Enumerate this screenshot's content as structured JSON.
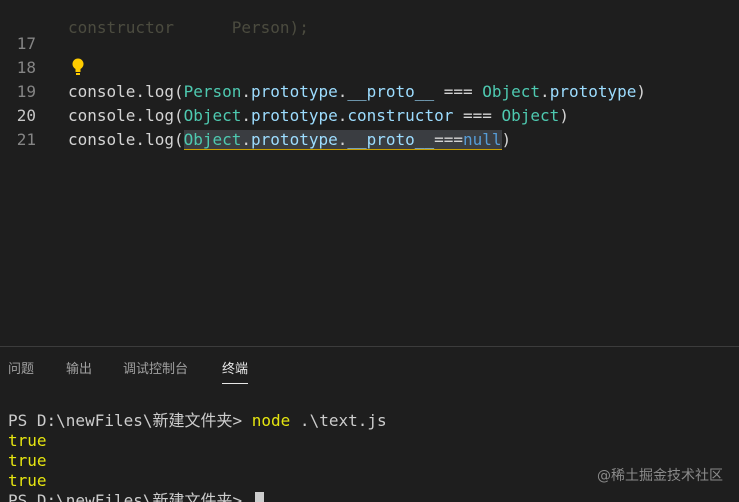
{
  "editor": {
    "top_partial": "constructor      Person);",
    "lines": [
      {
        "num": "17"
      },
      {
        "num": "18",
        "t1": "console.log(",
        "t2": "Person",
        "t3": ".",
        "t4": "prototype",
        "t5": ".",
        "t6": "__proto__",
        "t7": " === ",
        "t8": "Object",
        "t9": ".",
        "t10": "prototype",
        "t11": ")"
      },
      {
        "num": "19",
        "t1": "console.log(",
        "t2": "Object",
        "t3": ".",
        "t4": "prototype",
        "t5": ".",
        "t6": "constructor",
        "t7": " === ",
        "t8": "Object",
        "t9": ")"
      },
      {
        "num": "20",
        "t1": "console.log(",
        "t2": "Object",
        "t3": ".",
        "t4": "prototype",
        "t5": ".",
        "t6": "__proto__",
        "t7": "===",
        "t8": "null",
        "t9": ")"
      },
      {
        "num": "21"
      }
    ]
  },
  "panel": {
    "tabs": [
      "问题",
      "输出",
      "调试控制台",
      "终端"
    ],
    "active_tab": "终端"
  },
  "terminal": {
    "prompt": "PS D:\\newFiles\\新建文件夹> ",
    "command": "node",
    "argument": " .\\text.js",
    "outputs": [
      "true",
      "true",
      "true"
    ],
    "last_prompt": "PS D:\\newFiles\\新建文件夹> "
  },
  "watermark": "@稀土掘金技术社区",
  "colors": {
    "background": "#1e1e1e",
    "class_color": "#4ec9b0",
    "property_color": "#9cdcfe",
    "keyword_color": "#569cd6",
    "terminal_yellow": "#e5e510"
  }
}
